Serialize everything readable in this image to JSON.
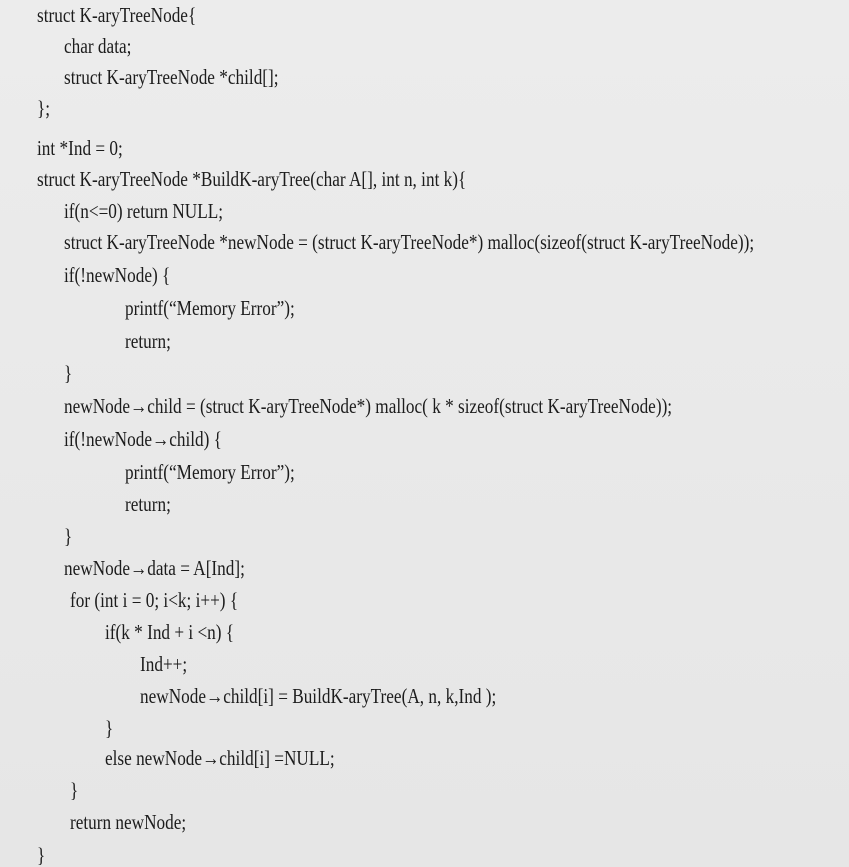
{
  "code": {
    "lines": [
      "struct K-aryTreeNode{",
      "char data;",
      "struct K-aryTreeNode *child[];",
      "};",
      "int *Ind = 0;",
      "struct K-aryTreeNode *BuildK-aryTree(char A[], int n, int k){",
      "if(n<=0) return NULL;",
      "struct K-aryTreeNode *newNode = (struct K-aryTreeNode*) malloc(sizeof(struct K-aryTreeNode));",
      "if(!newNode) {",
      "printf(“Memory Error”);",
      "return;",
      "}",
      "newNode→child = (struct K-aryTreeNode*) malloc( k * sizeof(struct K-aryTreeNode));",
      "if(!newNode→child) {",
      "printf(“Memory Error”);",
      "return;",
      "}",
      "newNode→data = A[Ind];",
      "for (int i = 0; i<k; i++) {",
      "if(k * Ind + i <n) {",
      "Ind++;",
      "newNode→child[i] = BuildK-aryTree(A, n, k,Ind );",
      "}",
      "else newNode→child[i] =NULL;",
      "}",
      "return newNode;",
      "}"
    ]
  }
}
